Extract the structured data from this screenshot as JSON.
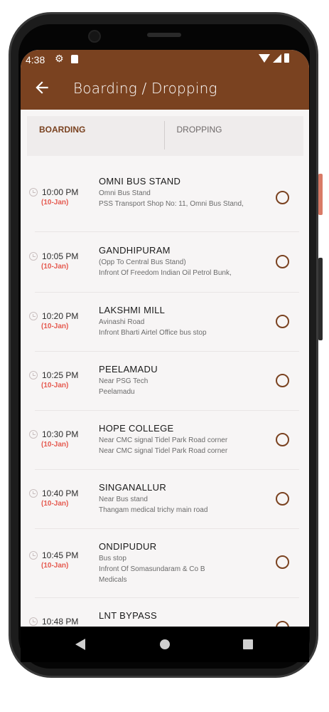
{
  "status": {
    "time": "4:38"
  },
  "header": {
    "title": "Boarding / Dropping"
  },
  "tabs": [
    {
      "label": "BOARDING",
      "selected": true
    },
    {
      "label": "DROPPING",
      "selected": false
    }
  ],
  "stops": [
    {
      "time": "10:00 PM",
      "date": "(10-Jan)",
      "name": "OMNI BUS STAND",
      "lines": [
        "Omni Bus Stand",
        "PSS Transport Shop No: 11, Omni Bus Stand,"
      ]
    },
    {
      "time": "10:05 PM",
      "date": "(10-Jan)",
      "name": "GANDHIPURAM",
      "lines": [
        "(Opp To Central Bus Stand)",
        "Infront Of Freedom Indian Oil Petrol Bunk,"
      ]
    },
    {
      "time": "10:20 PM",
      "date": "(10-Jan)",
      "name": "LAKSHMI MILL",
      "lines": [
        "Avinashi Road",
        " Infront Bharti Airtel Office bus stop"
      ]
    },
    {
      "time": "10:25 PM",
      "date": "(10-Jan)",
      "name": "PEELAMADU",
      "lines": [
        "Near PSG Tech",
        "Peelamadu"
      ]
    },
    {
      "time": "10:30 PM",
      "date": "(10-Jan)",
      "name": "HOPE COLLEGE",
      "lines": [
        "Near CMC signal Tidel Park Road corner",
        "Near CMC signal Tidel Park Road corner"
      ]
    },
    {
      "time": "10:40 PM",
      "date": "(10-Jan)",
      "name": "SINGANALLUR",
      "lines": [
        " Near Bus stand",
        "Thangam medical trichy main road"
      ]
    },
    {
      "time": "10:45 PM",
      "date": "(10-Jan)",
      "name": "ONDIPUDUR",
      "lines": [
        "Bus stop",
        "Infront Of  Somasundaram & Co B",
        "Medicals"
      ]
    },
    {
      "time": "10:48 PM",
      "date": "",
      "name": "LNT BYPASS",
      "lines": []
    }
  ],
  "colors": {
    "accent": "#7a4220",
    "date": "#e55a50"
  }
}
